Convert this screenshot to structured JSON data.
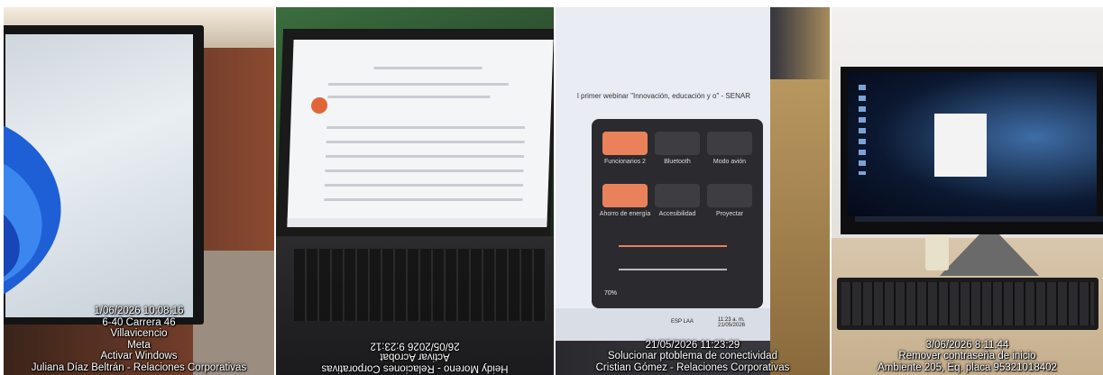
{
  "photos": [
    {
      "caption_lines": [
        "1/06/2026 10:08:16",
        "6-40 Carrera 46",
        "Villavicencio",
        "Meta",
        "Activar Windows",
        "Juliana Díaz Beltrán - Relaciones Corporativas"
      ]
    },
    {
      "caption_lines": [
        "26/05/2026 9:23:12",
        "Activar Acrobat",
        "Heidy Moreno - Relaciones Corporativas"
      ],
      "caption_rotated": true
    },
    {
      "screen": {
        "heading": "l primer webinar \"Innovación, educación y o\" - SENAR",
        "quick_settings": [
          "Funcionarios 2",
          "Bluetooth",
          "Modo avión",
          "Ahorro de energía",
          "Accesibilidad",
          "Proyectar"
        ],
        "battery": "70%",
        "clock": "11:23 a. m. 21/05/2026",
        "lang": "ESP LAA"
      },
      "caption_lines": [
        "21/05/2026 11:23:29",
        "Solucionar ptoblema de conectividad",
        "Cristian Gómez - Relaciones Corporativas"
      ]
    },
    {
      "caption_lines": [
        "3/06/2026 8:11:44",
        "Remover contraseña de inicio",
        "Ambiente 205, Eq. placa 95321018402"
      ]
    }
  ]
}
